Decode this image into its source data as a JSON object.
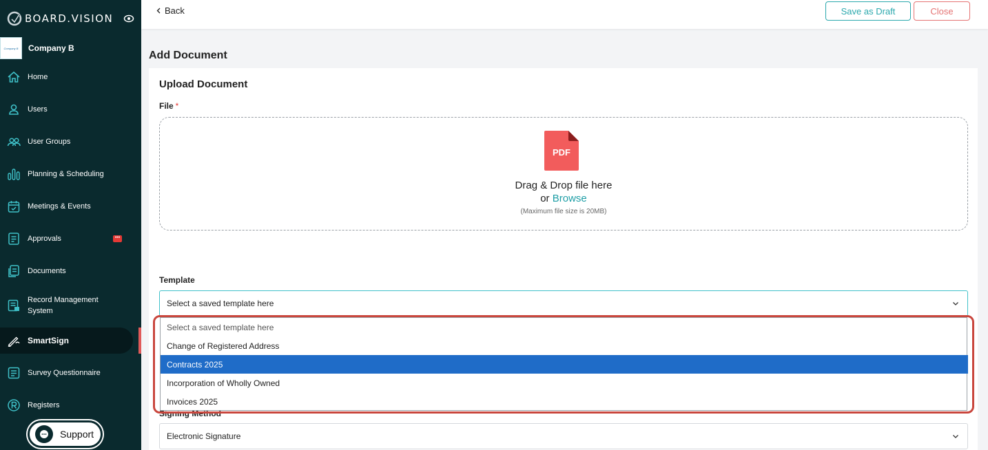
{
  "brand": {
    "name": "BOARD.VISION",
    "icon": "board-vision-logo"
  },
  "company": {
    "name": "Company B",
    "logo_text": "Company B"
  },
  "nav": {
    "items": [
      {
        "label": "Home",
        "icon": "home-icon"
      },
      {
        "label": "Users",
        "icon": "user-icon"
      },
      {
        "label": "User Groups",
        "icon": "users-icon"
      },
      {
        "label": "Planning & Scheduling",
        "icon": "chart-icon"
      },
      {
        "label": "Meetings & Events",
        "icon": "calendar-icon"
      },
      {
        "label": "Approvals",
        "icon": "clipboard-icon",
        "badge": "•••"
      },
      {
        "label": "Documents",
        "icon": "document-icon"
      },
      {
        "label": "Record Management System",
        "icon": "record-icon"
      },
      {
        "label": "SmartSign",
        "icon": "pen-icon",
        "active": true
      },
      {
        "label": "Survey Questionnaire",
        "icon": "survey-icon"
      },
      {
        "label": "Registers",
        "icon": "registered-icon"
      }
    ],
    "support_label": "Support"
  },
  "topbar": {
    "back_label": "Back",
    "save_draft_label": "Save as Draft",
    "close_label": "Close"
  },
  "page": {
    "title": "Add Document",
    "section_title": "Upload Document",
    "file_label": "File",
    "required_mark": "*",
    "dropzone": {
      "icon_text": "PDF",
      "line1": "Drag & Drop file here",
      "or": "or",
      "browse": "Browse",
      "note": "(Maximum file size is 20MB)"
    },
    "template": {
      "label": "Template",
      "value": "Select a saved template here",
      "options": [
        "Select a saved template here",
        "Change of Registered Address",
        "Contracts 2025",
        "Incorporation of Wholly Owned",
        "Invoices 2025"
      ],
      "highlighted_option": "Contracts 2025"
    },
    "signing_method": {
      "label": "Signing Method",
      "value": "Electronic Signature"
    }
  },
  "colors": {
    "sidebar": "#0a2a2e",
    "accent": "#2aa8ad",
    "danger": "#e57373",
    "selected": "#1f6cc8",
    "highlight": "#c9463d"
  }
}
